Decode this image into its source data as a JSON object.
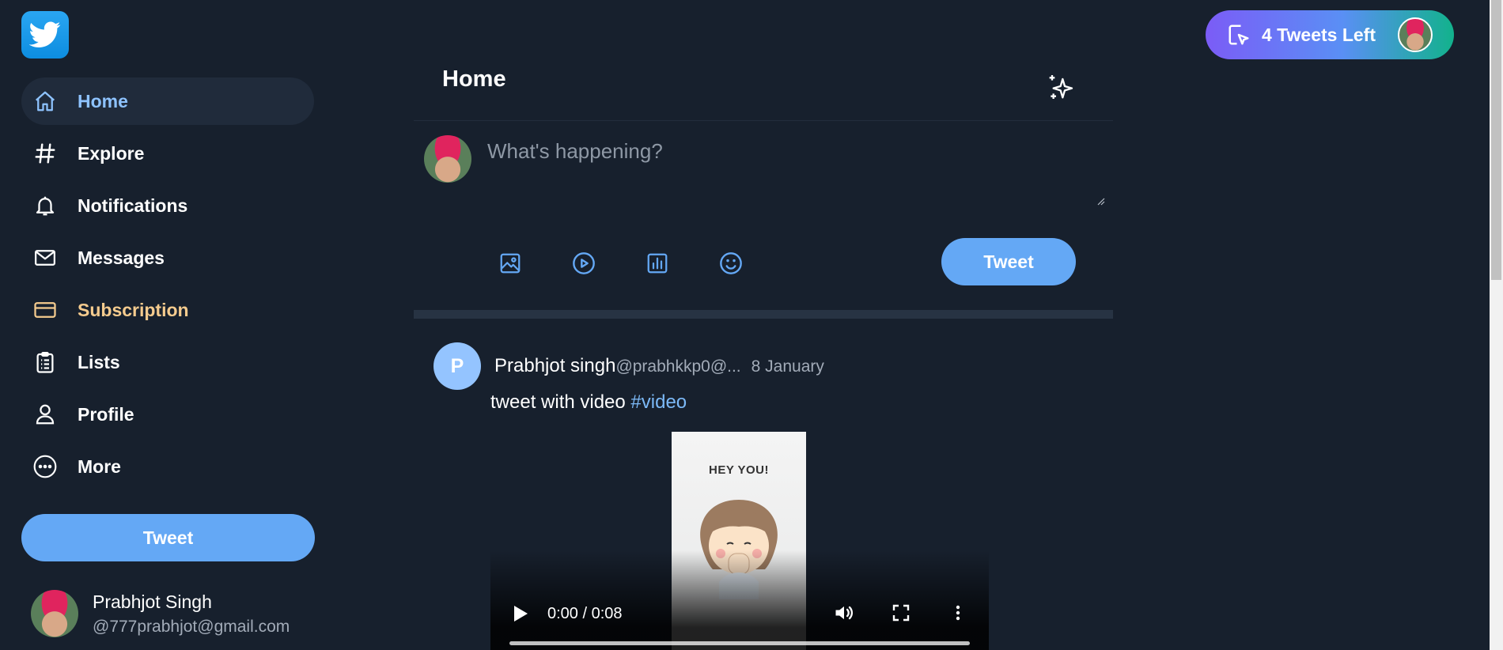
{
  "sidebar": {
    "logo_icon": "twitter-bird-icon",
    "nav": [
      {
        "label": "Home",
        "icon": "home-icon",
        "active": true
      },
      {
        "label": "Explore",
        "icon": "hash-icon"
      },
      {
        "label": "Notifications",
        "icon": "bell-icon"
      },
      {
        "label": "Messages",
        "icon": "mail-icon"
      },
      {
        "label": "Subscription",
        "icon": "card-icon"
      },
      {
        "label": "Lists",
        "icon": "clipboard-list-icon"
      },
      {
        "label": "Profile",
        "icon": "user-icon"
      },
      {
        "label": "More",
        "icon": "more-circle-icon"
      }
    ],
    "tweet_label": "Tweet",
    "user": {
      "name": "Prabhjot Singh",
      "email": "@777prabhjot@gmail.com"
    }
  },
  "main": {
    "title": "Home",
    "compose": {
      "placeholder": "What's happening?",
      "tweet_label": "Tweet"
    },
    "post": {
      "avatar_letter": "P",
      "name": "Prabhjot singh",
      "handle": "@prabhkkp0@...",
      "date": "8 January",
      "text": "tweet with video ",
      "hashtag": "#video",
      "video": {
        "frame_text": "HEY YOU!",
        "time": "0:00 / 0:08"
      }
    }
  },
  "topbar": {
    "tweets_left_label": "4 Tweets Left"
  },
  "colors": {
    "background": "#17202d",
    "accent": "#64a8f5",
    "active_nav": "#8ec3ff",
    "subscription": "#f5cb8e"
  }
}
